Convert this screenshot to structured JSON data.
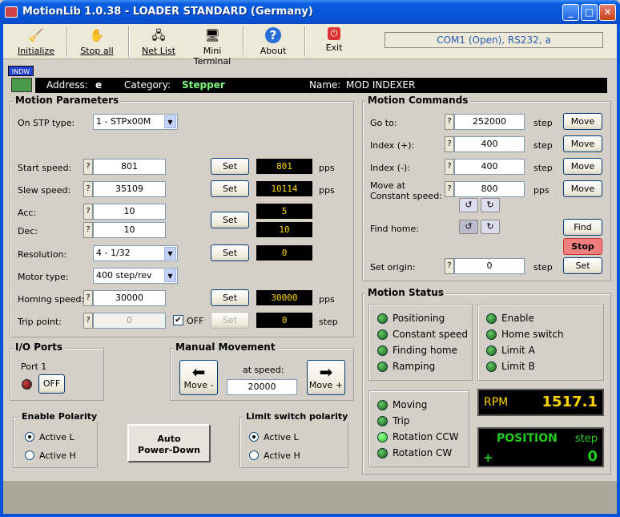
{
  "window": {
    "title": "MotionLib 1.0.38 - LOADER STANDARD (Germany)"
  },
  "toolbar": {
    "initialize": "Initialize",
    "stop_all": "Stop all",
    "net_list": "Net List",
    "mini_terminal": "Mini Terminal",
    "about": "About",
    "exit": "Exit",
    "com_status": "COM1 (Open), RS232, a"
  },
  "tab": {
    "label": "INDW"
  },
  "info": {
    "address_label": "Address:",
    "address": "e",
    "category_label": "Category:",
    "category": "Stepper",
    "name_label": "Name:",
    "name": "MOD INDEXER"
  },
  "motion_params": {
    "title": "Motion Parameters",
    "stp_type_label": "On STP type:",
    "stp_type": "1 - STPx00M",
    "start_speed_label": "Start speed:",
    "start_speed": "801",
    "start_speed_disp": "801",
    "slew_speed_label": "Slew speed:",
    "slew_speed": "35109",
    "slew_speed_disp": "10114",
    "acc_label": "Acc:",
    "acc": "10",
    "acc_disp": "5",
    "dec_label": "Dec:",
    "dec": "10",
    "dec_disp": "10",
    "resolution_label": "Resolution:",
    "resolution": "4 - 1/32",
    "resolution_disp": "0",
    "motor_type_label": "Motor type:",
    "motor_type": "400 step/rev",
    "homing_speed_label": "Homing speed:",
    "homing_speed": "30000",
    "homing_speed_disp": "30000",
    "trip_point_label": "Trip point:",
    "trip_point": "0",
    "trip_off": "OFF",
    "trip_disp": "0",
    "set": "Set",
    "q": "?",
    "unit_pps": "pps",
    "unit_step": "step"
  },
  "io_ports": {
    "title": "I/O  Ports",
    "port_label": "Port 1",
    "btn": "OFF"
  },
  "manual": {
    "title": "Manual Movement",
    "at_speed": "at speed:",
    "speed": "20000",
    "minus": "Move -",
    "plus": "Move +"
  },
  "enable_polarity": {
    "title": "Enable Polarity",
    "active_l": "Active L",
    "active_h": "Active H"
  },
  "auto_power": {
    "line1": "Auto",
    "line2": "Power-Down"
  },
  "limit_polarity": {
    "title": "Limit switch polarity",
    "active_l": "Active L",
    "active_h": "Active H"
  },
  "motion_cmds": {
    "title": "Motion Commands",
    "goto_label": "Go to:",
    "goto": "252000",
    "index_plus_label": "Index (+):",
    "index_plus": "400",
    "index_minus_label": "Index (-):",
    "index_minus": "400",
    "move_const_label1": "Move at",
    "move_const_label2": "Constant speed:",
    "move_const": "800",
    "find_home_label": "Find home:",
    "find": "Find",
    "stop": "Stop",
    "set_origin_label": "Set origin:",
    "set_origin": "0",
    "set": "Set",
    "move": "Move",
    "q": "?",
    "unit_step": "step",
    "unit_pps": "pps"
  },
  "motion_status": {
    "title": "Motion Status",
    "left1": [
      "Positioning",
      "Constant speed",
      "Finding home",
      "Ramping"
    ],
    "right1": [
      "Enable",
      "Home switch",
      "Limit A",
      "Limit B"
    ],
    "left2": [
      "Moving",
      "Trip",
      "Rotation CCW",
      "Rotation CW"
    ],
    "rpm_label": "RPM",
    "rpm": "1517.1",
    "pos_label": "POSITION",
    "pos_unit": "step",
    "pos_sign": "+",
    "pos": "0"
  },
  "colors": {
    "accent": "#0553d8",
    "display_text": "#ffd700",
    "led_green": "#2c2",
    "stop_btn": "#f08080"
  }
}
